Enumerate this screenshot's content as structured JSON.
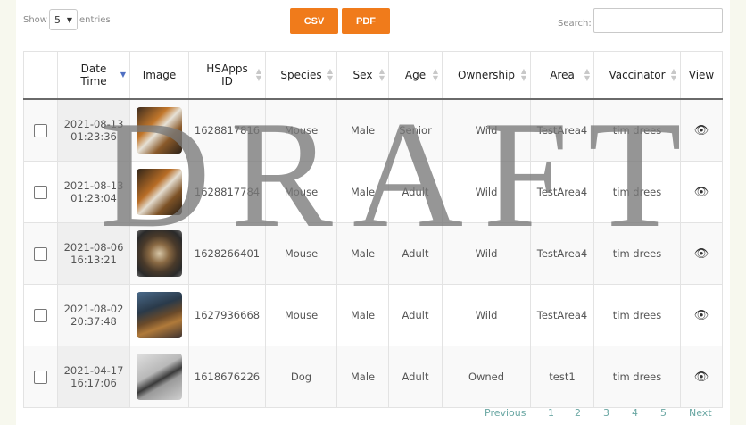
{
  "controls": {
    "show_label": "Show",
    "entries_value": "5",
    "entries_label": "entries",
    "csv_label": "CSV",
    "pdf_label": "PDF",
    "search_label": "Search:",
    "search_value": ""
  },
  "table": {
    "headers": [
      "",
      "Date Time",
      "Image",
      "HSApps ID",
      "Species",
      "Sex",
      "Age",
      "Ownership",
      "Area",
      "Vaccinator",
      "View"
    ],
    "rows": [
      {
        "date": "2021-08-13",
        "time": "01:23:36",
        "id": "1628817816",
        "species": "Mouse",
        "sex": "Male",
        "age": "Senior",
        "ownership": "Wild",
        "area": "TestArea4",
        "vaccinator": "tim drees"
      },
      {
        "date": "2021-08-13",
        "time": "01:23:04",
        "id": "1628817784",
        "species": "Mouse",
        "sex": "Male",
        "age": "Adult",
        "ownership": "Wild",
        "area": "TestArea4",
        "vaccinator": "tim drees"
      },
      {
        "date": "2021-08-06",
        "time": "16:13:21",
        "id": "1628266401",
        "species": "Mouse",
        "sex": "Male",
        "age": "Adult",
        "ownership": "Wild",
        "area": "TestArea4",
        "vaccinator": "tim drees"
      },
      {
        "date": "2021-08-02",
        "time": "20:37:48",
        "id": "1627936668",
        "species": "Mouse",
        "sex": "Male",
        "age": "Adult",
        "ownership": "Wild",
        "area": "TestArea4",
        "vaccinator": "tim drees"
      },
      {
        "date": "2021-04-17",
        "time": "16:17:06",
        "id": "1618676226",
        "species": "Dog",
        "sex": "Male",
        "age": "Adult",
        "ownership": "Owned",
        "area": "test1",
        "vaccinator": "tim drees"
      }
    ]
  },
  "watermark": "DRAFT",
  "pagination": {
    "previous": "Previous",
    "pages": [
      "1",
      "2",
      "3",
      "4",
      "5"
    ],
    "next": "Next"
  },
  "colors": {
    "accent": "#f07b1b",
    "link": "#6aa7a3",
    "sort_active": "#4f6fc2"
  }
}
